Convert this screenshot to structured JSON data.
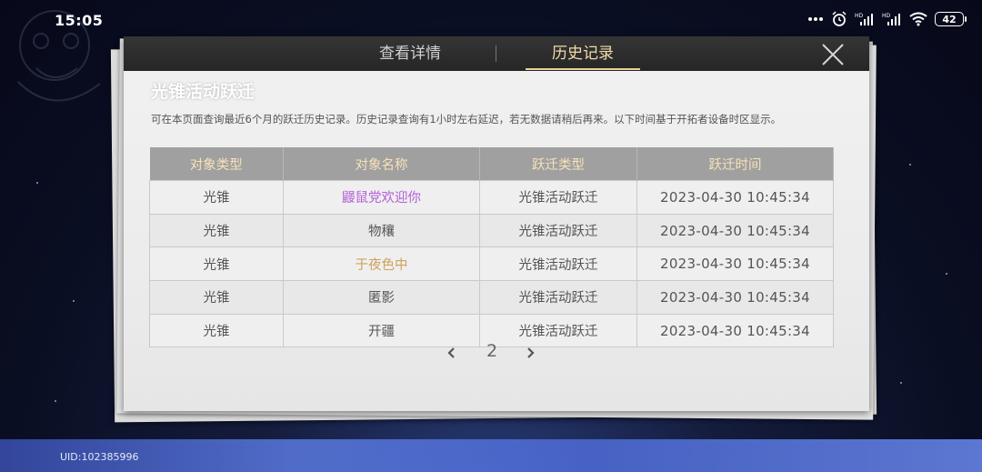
{
  "status_bar": {
    "time": "15:05",
    "battery": "42",
    "icons": [
      "dots-icon",
      "alarm-icon",
      "hd-signal-icon",
      "hd-signal-icon",
      "wifi-icon",
      "battery-icon"
    ]
  },
  "tabs": [
    {
      "label": "查看详情",
      "active": false
    },
    {
      "label": "历史记录",
      "active": true
    }
  ],
  "section_title": "光锥活动跃迁",
  "notice": "可在本页面查询最近6个月的跃迁历史记录。历史记录查询有1小时左右延迟，若无数据请稍后再来。以下时间基于开拓者设备时区显示。",
  "table": {
    "headers": [
      "对象类型",
      "对象名称",
      "跃迁类型",
      "跃迁时间"
    ],
    "rows": [
      {
        "type": "光锥",
        "name": "鼹鼠党欢迎你",
        "name_color": "#b45fd8",
        "warp": "光锥活动跃迁",
        "time": "2023-04-30 10:45:34"
      },
      {
        "type": "光锥",
        "name": "物穰",
        "name_color": "#555555",
        "warp": "光锥活动跃迁",
        "time": "2023-04-30 10:45:34"
      },
      {
        "type": "光锥",
        "name": "于夜色中",
        "name_color": "#d0a15a",
        "warp": "光锥活动跃迁",
        "time": "2023-04-30 10:45:34"
      },
      {
        "type": "光锥",
        "name": "匿影",
        "name_color": "#555555",
        "warp": "光锥活动跃迁",
        "time": "2023-04-30 10:45:34"
      },
      {
        "type": "光锥",
        "name": "开疆",
        "name_color": "#555555",
        "warp": "光锥活动跃迁",
        "time": "2023-04-30 10:45:34"
      }
    ]
  },
  "pagination": {
    "current": "2"
  },
  "uid": "UID:102385996",
  "colors": {
    "tab_active": "#f1dba8",
    "header_bg": "#2e2e2e",
    "table_header_bg": "#a0a0a0",
    "table_header_text": "#f6e2b8"
  }
}
